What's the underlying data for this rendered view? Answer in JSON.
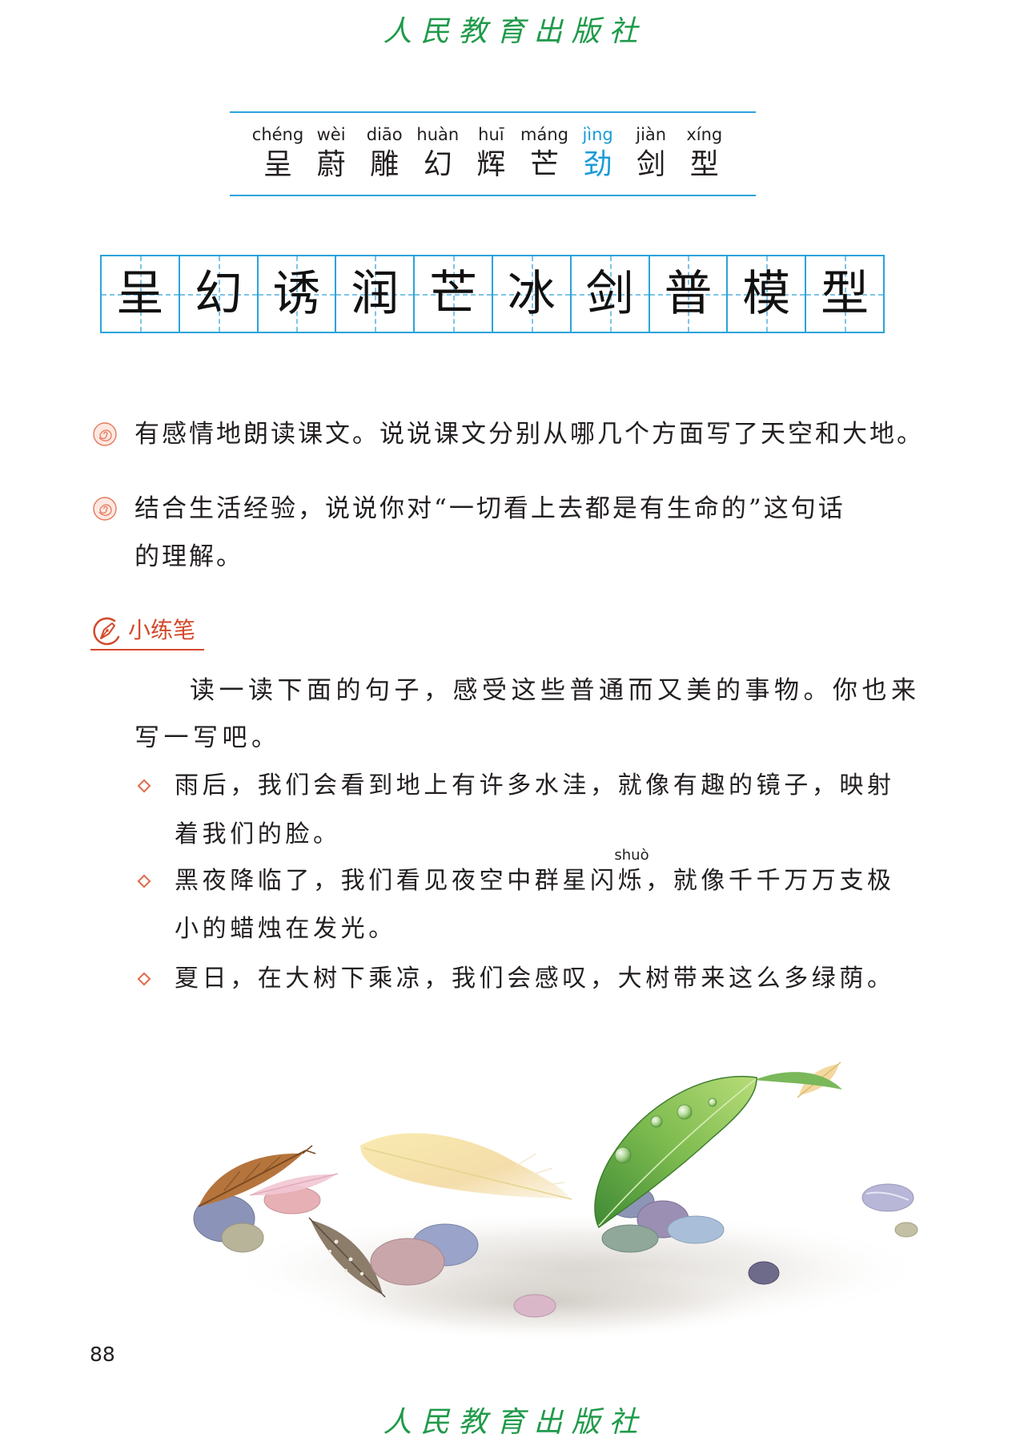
{
  "publisher": {
    "watermark_top": "人民教育出版社",
    "watermark_bottom": "人民教育出版社"
  },
  "vocab": {
    "items": [
      {
        "pinyin": "chéng",
        "char": "呈"
      },
      {
        "pinyin": "wèi",
        "char": "蔚"
      },
      {
        "pinyin": "diāo",
        "char": "雕"
      },
      {
        "pinyin": "huàn",
        "char": "幻"
      },
      {
        "pinyin": "huī",
        "char": "辉"
      },
      {
        "pinyin": "máng",
        "char": "芒"
      },
      {
        "pinyin": "jìng",
        "char": "劲",
        "highlighted": true
      },
      {
        "pinyin": "jiàn",
        "char": "剑"
      },
      {
        "pinyin": "xíng",
        "char": "型"
      }
    ]
  },
  "writing_grid": {
    "chars": [
      "呈",
      "幻",
      "诱",
      "润",
      "芒",
      "冰",
      "剑",
      "普",
      "模",
      "型"
    ]
  },
  "exercises": [
    {
      "lines": [
        "有感情地朗读课文。说说课文分别从哪几个方面写了天空和大地。"
      ]
    },
    {
      "lines": [
        "结合生活经验，说说你对“一切看上去都是有生命的”这句话",
        "的理解。"
      ]
    }
  ],
  "practice": {
    "title": "小练笔",
    "intro_lines": [
      "读一读下面的句子，感受这些普通而又美的事物。你也来",
      "写一写吧。"
    ],
    "examples": [
      {
        "lines": [
          "雨后，我们会看到地上有许多水洼，就像有趣的镜子，映射",
          "着我们的脸。"
        ]
      },
      {
        "annotation": "shuò",
        "lines": [
          "黑夜降临了，我们看见夜空中群星闪烁，就像千千万万支极",
          "小的蜡烛在发光。"
        ]
      },
      {
        "lines": [
          "夏日，在大树下乘凉，我们会感叹，大树带来这么多绿荫。"
        ]
      }
    ]
  },
  "page_number": "88",
  "icons": {
    "exercise_bullet": "spiral-bullet-icon",
    "practice_heading": "pen-icon",
    "example_bullet": "diamond-icon"
  },
  "colors": {
    "brand_green": "#1f9a4a",
    "rule_blue": "#2ba3db",
    "grid_dash": "#7cc4e8",
    "highlight_blue": "#1a9bd7",
    "accent_orange": "#e26a4a",
    "heading_red": "#d4492a",
    "text_color": "#231f20"
  }
}
